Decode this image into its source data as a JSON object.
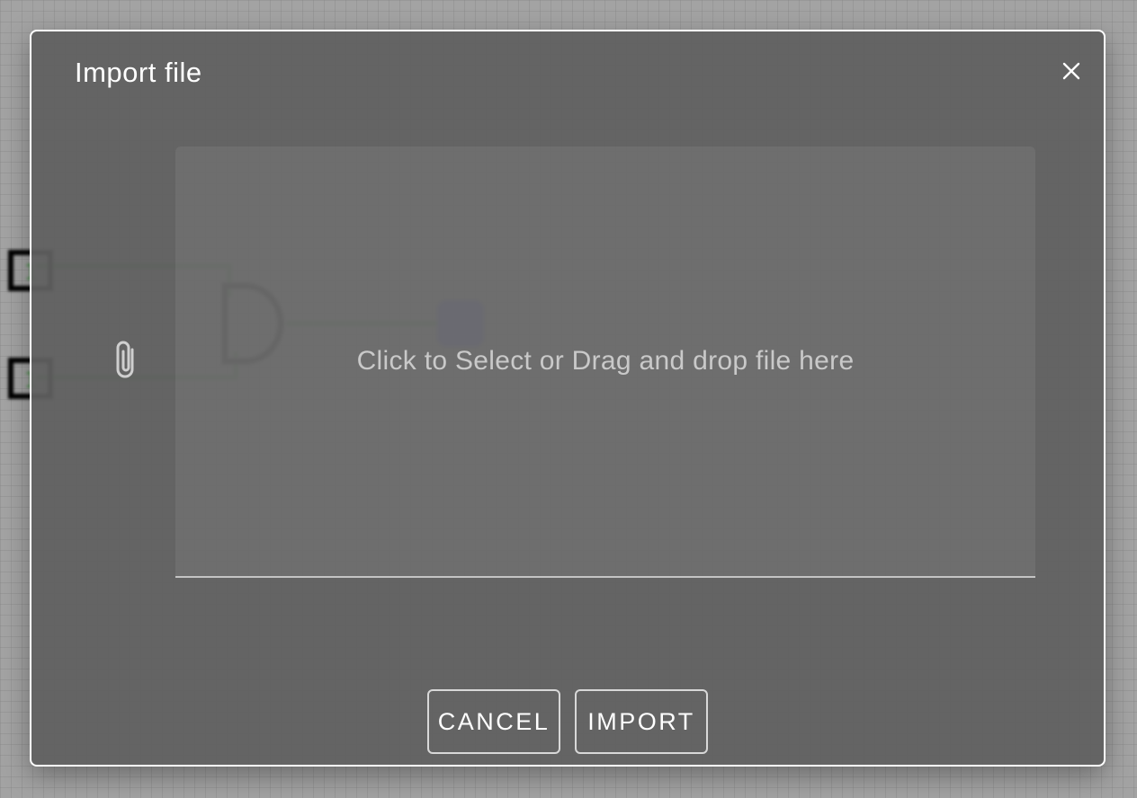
{
  "dialog": {
    "title": "Import file",
    "close_icon": "close-icon",
    "attach_icon": "paperclip-icon",
    "drop_text": "Click to Select or Drag and drop file here",
    "cancel_label": "CANCEL",
    "import_label": "IMPORT"
  },
  "background": {
    "input_1_value": "1",
    "input_2_value": "1"
  },
  "colors": {
    "dialog_bg": "#606060",
    "wire": "#5d9a5a",
    "output_led": "#6b6bd0"
  }
}
